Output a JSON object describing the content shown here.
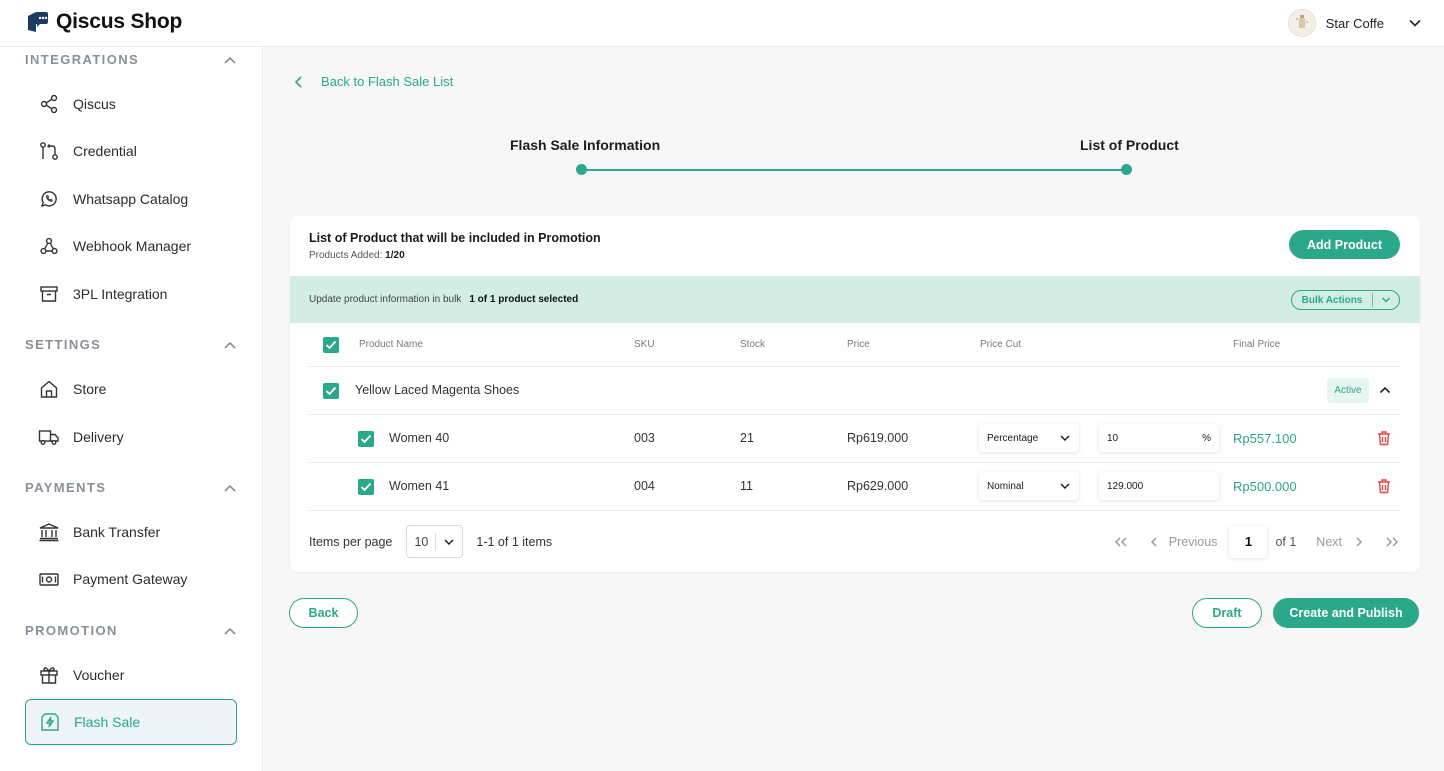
{
  "app": {
    "brand": "Qiscus Shop",
    "user_name": "Star Coffe"
  },
  "colors": {
    "accent": "#2aa889",
    "danger": "#e04848",
    "bulk_bg": "#d3ede4"
  },
  "sidebar": {
    "sections": [
      {
        "title": "INTEGRATIONS",
        "items": [
          {
            "label": "Qiscus",
            "icon": "share-icon"
          },
          {
            "label": "Credential",
            "icon": "key-branch-icon"
          },
          {
            "label": "Whatsapp Catalog",
            "icon": "whatsapp-icon"
          },
          {
            "label": "Webhook Manager",
            "icon": "webhook-icon"
          },
          {
            "label": "3PL Integration",
            "icon": "archive-box-icon"
          }
        ]
      },
      {
        "title": "SETTINGS",
        "items": [
          {
            "label": "Store",
            "icon": "house-icon"
          },
          {
            "label": "Delivery",
            "icon": "truck-icon"
          }
        ]
      },
      {
        "title": "PAYMENTS",
        "items": [
          {
            "label": "Bank Transfer",
            "icon": "bank-icon"
          },
          {
            "label": "Payment Gateway",
            "icon": "banknote-icon"
          }
        ]
      },
      {
        "title": "PROMOTION",
        "items": [
          {
            "label": "Voucher",
            "icon": "gift-icon"
          },
          {
            "label": "Flash Sale",
            "icon": "flash-sale-icon",
            "active": true
          }
        ]
      }
    ]
  },
  "main": {
    "back_link": "Back to Flash Sale List",
    "steps": [
      "Flash Sale Information",
      "List of Product"
    ],
    "card": {
      "title": "List of Product that will be included in Promotion",
      "products_added_label": "Products Added:",
      "products_added_value": "1/20",
      "add_button": "Add Product",
      "bulk": {
        "text": "Update product information in bulk",
        "selected": "1 of 1 product selected",
        "button": "Bulk Actions"
      },
      "columns": [
        "Product Name",
        "SKU",
        "Stock",
        "Price",
        "Price Cut",
        "Final Price"
      ],
      "product": {
        "name": "Yellow Laced Magenta Shoes",
        "status": "Active",
        "variants": [
          {
            "name": "Women 40",
            "sku": "003",
            "stock": "21",
            "price": "Rp619.000",
            "cut_type": "Percentage",
            "cut_value": "10",
            "cut_suffix": "%",
            "final": "Rp557.100"
          },
          {
            "name": "Women 41",
            "sku": "004",
            "stock": "11",
            "price": "Rp629.000",
            "cut_type": "Nominal",
            "cut_value": "129.000",
            "cut_suffix": "",
            "final": "Rp500.000"
          }
        ]
      },
      "pagination": {
        "items_per_page_label": "Items per page",
        "per_page": "10",
        "range": "1-1 of 1 items",
        "previous": "Previous",
        "current_page": "1",
        "of_pages": "of 1",
        "next": "Next"
      }
    },
    "footer": {
      "back": "Back",
      "draft": "Draft",
      "publish": "Create and Publish"
    }
  }
}
